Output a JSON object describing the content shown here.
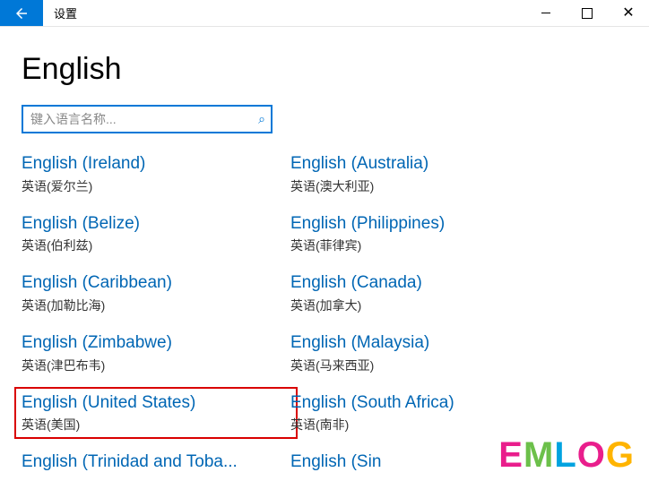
{
  "window": {
    "title": "设置",
    "close_glyph": "✕"
  },
  "page": {
    "heading": "English"
  },
  "search": {
    "placeholder": "键入语言名称...",
    "icon_glyph": "⌕"
  },
  "languages": [
    {
      "name": "English (Ireland)",
      "native": "英语(爱尔兰)",
      "highlight": false
    },
    {
      "name": "English (Australia)",
      "native": "英语(澳大利亚)",
      "highlight": false
    },
    {
      "name": "English (Belize)",
      "native": "英语(伯利兹)",
      "highlight": false
    },
    {
      "name": "English (Philippines)",
      "native": "英语(菲律宾)",
      "highlight": false
    },
    {
      "name": "English (Caribbean)",
      "native": "英语(加勒比海)",
      "highlight": false
    },
    {
      "name": "English (Canada)",
      "native": "英语(加拿大)",
      "highlight": false
    },
    {
      "name": "English (Zimbabwe)",
      "native": "英语(津巴布韦)",
      "highlight": false
    },
    {
      "name": "English (Malaysia)",
      "native": "英语(马来西亚)",
      "highlight": false
    },
    {
      "name": "English (United States)",
      "native": "英语(美国)",
      "highlight": true
    },
    {
      "name": "English (South Africa)",
      "native": "英语(南非)",
      "highlight": false
    },
    {
      "name": "English (Trinidad and Toba...",
      "native": "",
      "highlight": false
    },
    {
      "name": "English (Sin",
      "native": "",
      "highlight": false
    }
  ],
  "watermark": {
    "e": "E",
    "m": "M",
    "l": "L",
    "o": "O",
    "g": "G"
  }
}
